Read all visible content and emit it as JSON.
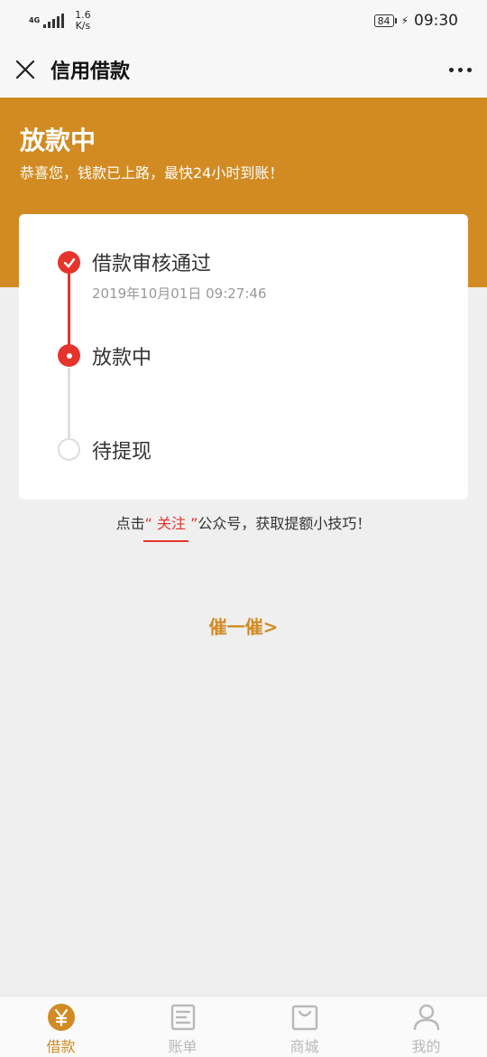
{
  "status_bar": {
    "network": "4G",
    "speed_value": "1.6",
    "speed_unit": "K/s",
    "battery": "84",
    "time": "09:30"
  },
  "nav": {
    "title": "信用借款",
    "close_icon": "close-icon",
    "more_icon": "more-dots-icon"
  },
  "hero": {
    "title": "放款中",
    "subtitle": "恭喜您，钱款已上路，最快24小时到账！"
  },
  "steps": [
    {
      "label": "借款审核通过",
      "time": "2019年10月01日 09:27:46",
      "state": "done"
    },
    {
      "label": "放款中",
      "time": "",
      "state": "active"
    },
    {
      "label": "待提现",
      "time": "",
      "state": "pending"
    }
  ],
  "follow": {
    "prefix": "点击",
    "open_quote": "“",
    "link": " 关注 ",
    "close_quote": "”",
    "suffix": "公众号，获取提额小技巧！"
  },
  "urge_button": "催一催>",
  "tabs": [
    {
      "label": "借款",
      "icon": "yen-circle-icon",
      "active": true
    },
    {
      "label": "账单",
      "icon": "bill-icon",
      "active": false
    },
    {
      "label": "商城",
      "icon": "shop-bag-icon",
      "active": false
    },
    {
      "label": "我的",
      "icon": "user-icon",
      "active": false
    }
  ],
  "colors": {
    "brand": "#d18b22",
    "accent_red": "#e5342c",
    "inactive_tab": "#b9b9b9"
  }
}
